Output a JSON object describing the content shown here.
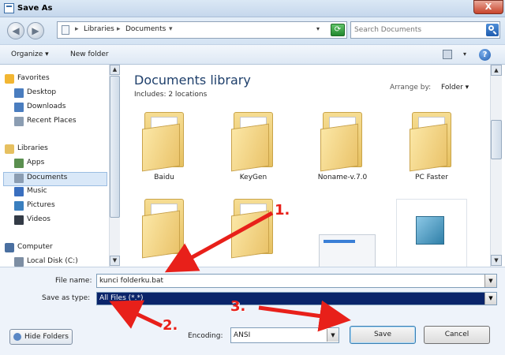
{
  "window": {
    "title": "Save As",
    "close_label": "X"
  },
  "address": {
    "crumbs": [
      "Libraries",
      "Documents"
    ],
    "separator": "▸",
    "dropdown": "▾",
    "refresh_glyph": "⟳"
  },
  "search": {
    "placeholder": "Search Documents"
  },
  "nav_buttons": {
    "back": "◀",
    "forward": "▶"
  },
  "toolbar": {
    "organize": "Organize ▾",
    "new_folder": "New folder",
    "view_dropdown": "▾",
    "help": "?"
  },
  "navpane": {
    "items": [
      {
        "label": "Favorites",
        "icon": "star-icon",
        "color": "#f2b632"
      },
      {
        "label": "Desktop",
        "icon": "desktop-icon",
        "color": "#4a7dbf"
      },
      {
        "label": "Downloads",
        "icon": "downloads-icon",
        "color": "#4a7dbf"
      },
      {
        "label": "Recent Places",
        "icon": "recent-places-icon",
        "color": "#8b9db2"
      },
      {
        "label": "Libraries",
        "icon": "libraries-icon",
        "color": "#e6c060"
      },
      {
        "label": "Apps",
        "icon": "apps-icon",
        "color": "#5a8f4f"
      },
      {
        "label": "Documents",
        "icon": "documents-icon",
        "color": "#8b9db2"
      },
      {
        "label": "Music",
        "icon": "music-icon",
        "color": "#3a6fbf"
      },
      {
        "label": "Pictures",
        "icon": "pictures-icon",
        "color": "#3a7fbf"
      },
      {
        "label": "Videos",
        "icon": "videos-icon",
        "color": "#333b46"
      },
      {
        "label": "Computer",
        "icon": "computer-icon",
        "color": "#4a6fa0"
      },
      {
        "label": "Local Disk (C:)",
        "icon": "disk-icon",
        "color": "#7d8ea3"
      }
    ],
    "scroll_up": "▲",
    "scroll_down": "▼"
  },
  "content": {
    "title": "Documents library",
    "includes": "Includes:  2 locations",
    "arrange_label": "Arrange by:",
    "arrange_value": "Folder ▾",
    "files": [
      {
        "name": "Baidu",
        "type": "folder"
      },
      {
        "name": "KeyGen",
        "type": "folder"
      },
      {
        "name": "Noname-v.7.0",
        "type": "folder"
      },
      {
        "name": "PC Faster",
        "type": "folder"
      },
      {
        "name": "",
        "type": "folder"
      },
      {
        "name": "",
        "type": "folder"
      },
      {
        "name": "",
        "type": "image"
      },
      {
        "name": "",
        "type": "file"
      }
    ]
  },
  "form": {
    "filename_label": "File name:",
    "filename_value": "kunci folderku.bat",
    "savetype_label": "Save as type:",
    "savetype_value": "All Files  (*.*)",
    "encoding_label": "Encoding:",
    "encoding_value": "ANSI",
    "dropdown": "▼"
  },
  "buttons": {
    "hide_folders": "Hide Folders",
    "save": "Save",
    "cancel": "Cancel"
  },
  "annotations": {
    "step1": "1.",
    "step2": "2.",
    "step3": "3."
  },
  "colors": {
    "annotation": "#e8201a",
    "selection": "#0a246a"
  }
}
